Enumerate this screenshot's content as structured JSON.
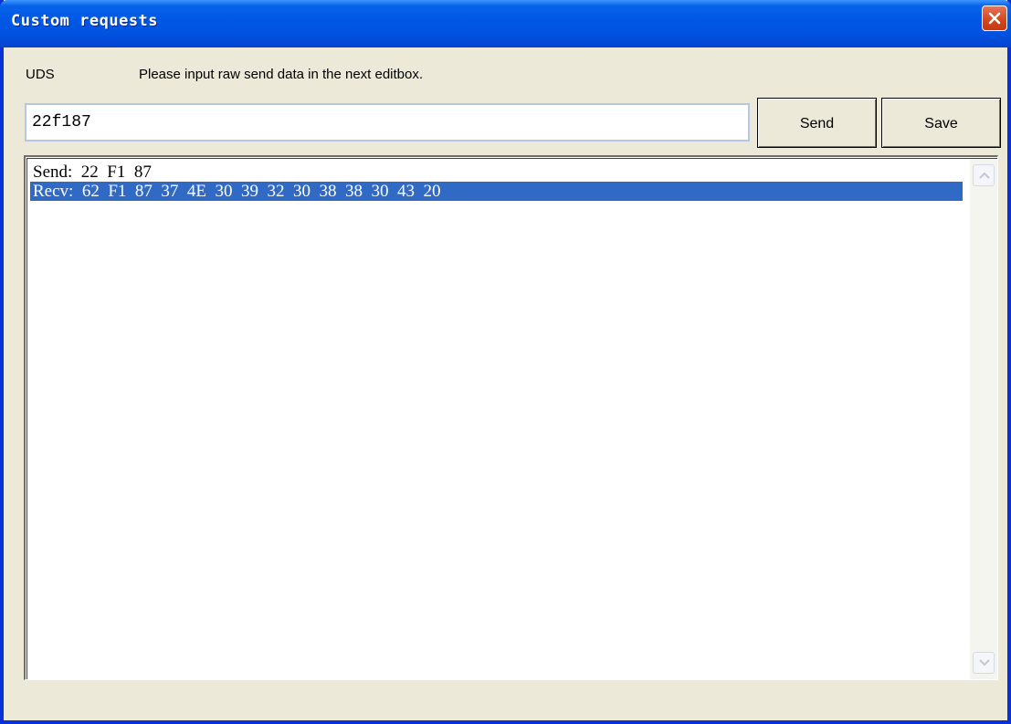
{
  "window": {
    "title": "Custom requests"
  },
  "labels": {
    "protocol": "UDS",
    "instruction": "Please input raw send data in the next editbox."
  },
  "input": {
    "value": "22f187"
  },
  "buttons": {
    "send": "Send",
    "save": "Save"
  },
  "log": {
    "rows": [
      {
        "text": "Send:  22  F1  87",
        "selected": false
      },
      {
        "text": "Recv:  62  F1  87  37  4E  30  39  32  30  38  38  30  43  20",
        "selected": true
      }
    ]
  },
  "colors": {
    "titlebar": "#0058e5",
    "selection": "#316ac5",
    "background": "#ece9d8",
    "close": "#d2461c"
  },
  "icons": {
    "close": "close-icon",
    "up": "scroll-up-arrow-icon",
    "down": "scroll-down-arrow-icon"
  }
}
